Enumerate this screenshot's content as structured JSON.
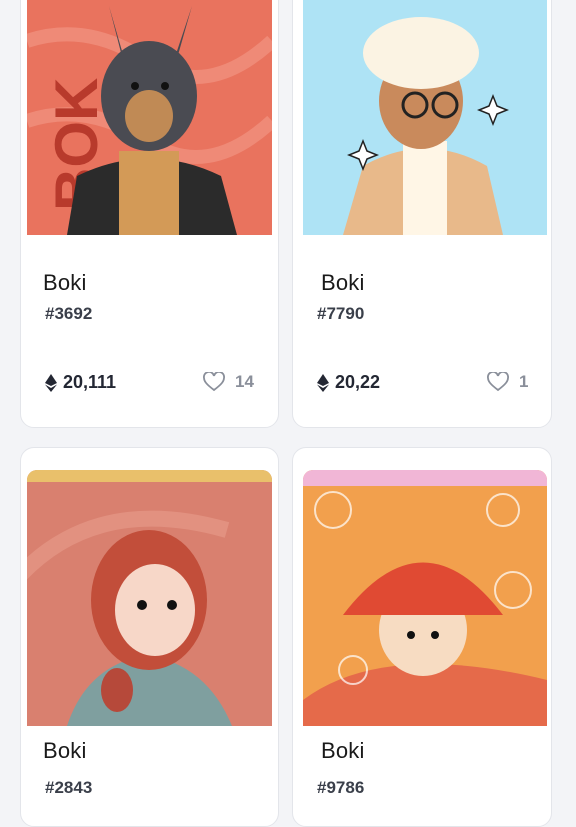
{
  "cards": [
    {
      "name": "Boki",
      "token_id": "#3692",
      "price": "20,111",
      "likes": "14",
      "bg": "#e9735e"
    },
    {
      "name": "Boki",
      "token_id": "#7790",
      "price": "20,22",
      "likes": "1",
      "bg": "#aee3f5"
    },
    {
      "name": "Boki",
      "token_id": "#2843",
      "bg": "#d9806f"
    },
    {
      "name": "Boki",
      "token_id": "#9786",
      "bg": "#f2a04d"
    }
  ],
  "icons": {
    "currency": "ethereum-icon",
    "like": "heart-icon"
  }
}
